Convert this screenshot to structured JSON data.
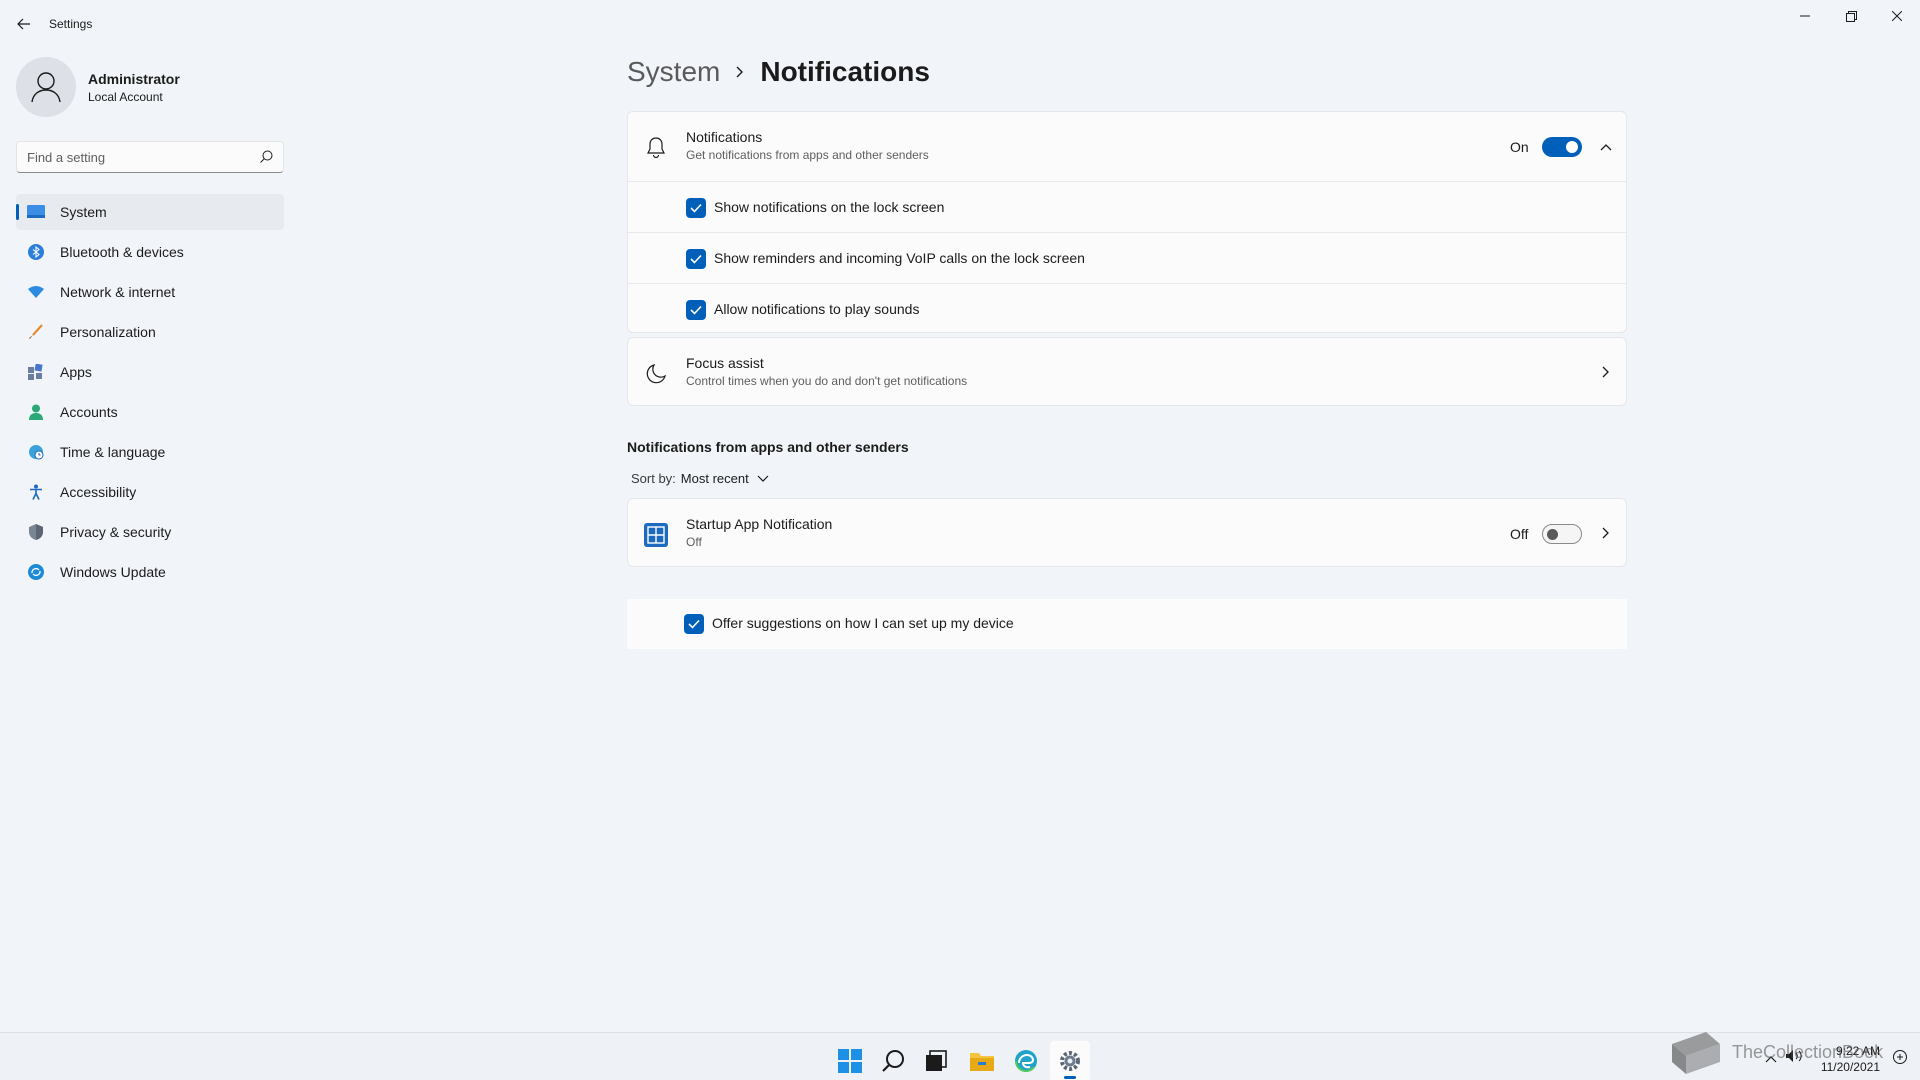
{
  "app": {
    "title": "Settings"
  },
  "user": {
    "name": "Administrator",
    "account_type": "Local Account"
  },
  "search": {
    "placeholder": "Find a setting"
  },
  "sidebar": {
    "items": [
      {
        "label": "System",
        "icon": "monitor-icon",
        "active": true
      },
      {
        "label": "Bluetooth & devices",
        "icon": "bluetooth-icon"
      },
      {
        "label": "Network & internet",
        "icon": "wifi-icon"
      },
      {
        "label": "Personalization",
        "icon": "brush-icon"
      },
      {
        "label": "Apps",
        "icon": "apps-icon"
      },
      {
        "label": "Accounts",
        "icon": "person-icon"
      },
      {
        "label": "Time & language",
        "icon": "globe-clock-icon"
      },
      {
        "label": "Accessibility",
        "icon": "accessibility-icon"
      },
      {
        "label": "Privacy & security",
        "icon": "shield-icon"
      },
      {
        "label": "Windows Update",
        "icon": "update-icon"
      }
    ]
  },
  "breadcrumb": {
    "parent": "System",
    "current": "Notifications"
  },
  "notifications": {
    "title": "Notifications",
    "subtitle": "Get notifications from apps and other senders",
    "state": "On",
    "options": [
      {
        "label": "Show notifications on the lock screen",
        "checked": true
      },
      {
        "label": "Show reminders and incoming VoIP calls on the lock screen",
        "checked": true
      },
      {
        "label": "Allow notifications to play sounds",
        "checked": true
      }
    ]
  },
  "focus_assist": {
    "title": "Focus assist",
    "subtitle": "Control times when you do and don't get notifications"
  },
  "senders": {
    "section_title": "Notifications from apps and other senders",
    "sort_label": "Sort by:",
    "sort_value": "Most recent",
    "apps": [
      {
        "name": "Startup App Notification",
        "status": "Off",
        "toggle_state": "Off"
      }
    ]
  },
  "suggestions": {
    "label": "Offer suggestions on how I can set up my device",
    "checked": true
  },
  "taskbar": {
    "time": "9:22 AM",
    "date": "11/20/2021",
    "watermark": "TheCollectionBook",
    "accent": "#005fb8"
  }
}
